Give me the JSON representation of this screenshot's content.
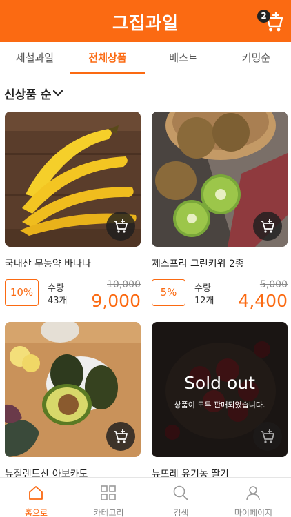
{
  "app": {
    "title": "그집과일",
    "brand_color": "#fb6a12"
  },
  "header": {
    "cart_count": "2"
  },
  "tabs": [
    {
      "label": "제철과일",
      "active": false
    },
    {
      "label": "전체상품",
      "active": true
    },
    {
      "label": "베스트",
      "active": false
    },
    {
      "label": "커밍순",
      "active": false
    }
  ],
  "sort": {
    "label": "신상품 순"
  },
  "products": [
    {
      "name": "국내산 무농약 바나나",
      "discount": "10%",
      "qty_label": "수량",
      "qty": "43개",
      "old_price": "10,000",
      "price": "9,000",
      "image": "banana"
    },
    {
      "name": "제스프리 그린키위 2종",
      "discount": "5%",
      "qty_label": "수량",
      "qty": "12개",
      "old_price": "5,000",
      "price": "4,400",
      "image": "kiwi"
    },
    {
      "name": "뉴질랜드산 아보카도",
      "image": "avocado"
    },
    {
      "name": "뉴뜨레 유기농 딸기",
      "image": "strawberry",
      "sold_out_title": "Sold out",
      "sold_out_text": "상품이 모두 판매되었습니다."
    }
  ],
  "bottom_nav": [
    {
      "label": "홈으로",
      "icon": "home-icon",
      "active": true
    },
    {
      "label": "카테고리",
      "icon": "grid-icon",
      "active": false
    },
    {
      "label": "검색",
      "icon": "search-icon",
      "active": false
    },
    {
      "label": "마이페이지",
      "icon": "user-icon",
      "active": false
    }
  ]
}
